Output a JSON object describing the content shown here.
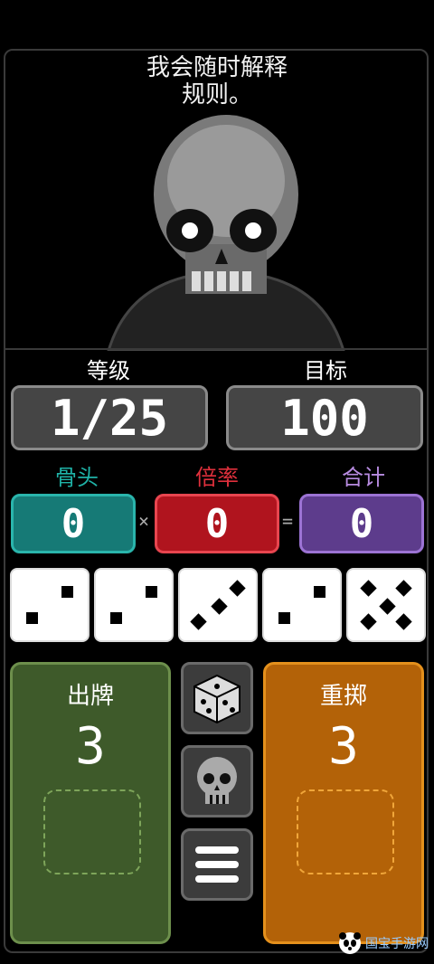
{
  "dialog": {
    "line1": "我会随时解释",
    "line2": "规则。"
  },
  "stats": {
    "level_label": "等级",
    "level_value": "1/25",
    "target_label": "目标",
    "target_value": "100"
  },
  "score": {
    "bones_label": "骨头",
    "bones_value": "0",
    "mult_label": "倍率",
    "mult_value": "0",
    "total_label": "合计",
    "total_value": "0",
    "times_symbol": "×",
    "equals_symbol": "="
  },
  "dice": [
    2,
    2,
    3,
    2,
    5
  ],
  "play": {
    "label": "出牌",
    "count": "3"
  },
  "reroll": {
    "label": "重掷",
    "count": "3"
  },
  "icons": [
    "dice-icon",
    "skull-icon",
    "menu-icon"
  ],
  "watermark": "国宝手游网",
  "colors": {
    "bones": "#167a76",
    "mult": "#b0141e",
    "total": "#5d3c8c",
    "play": "#3e5a2a",
    "reroll": "#b36208"
  }
}
